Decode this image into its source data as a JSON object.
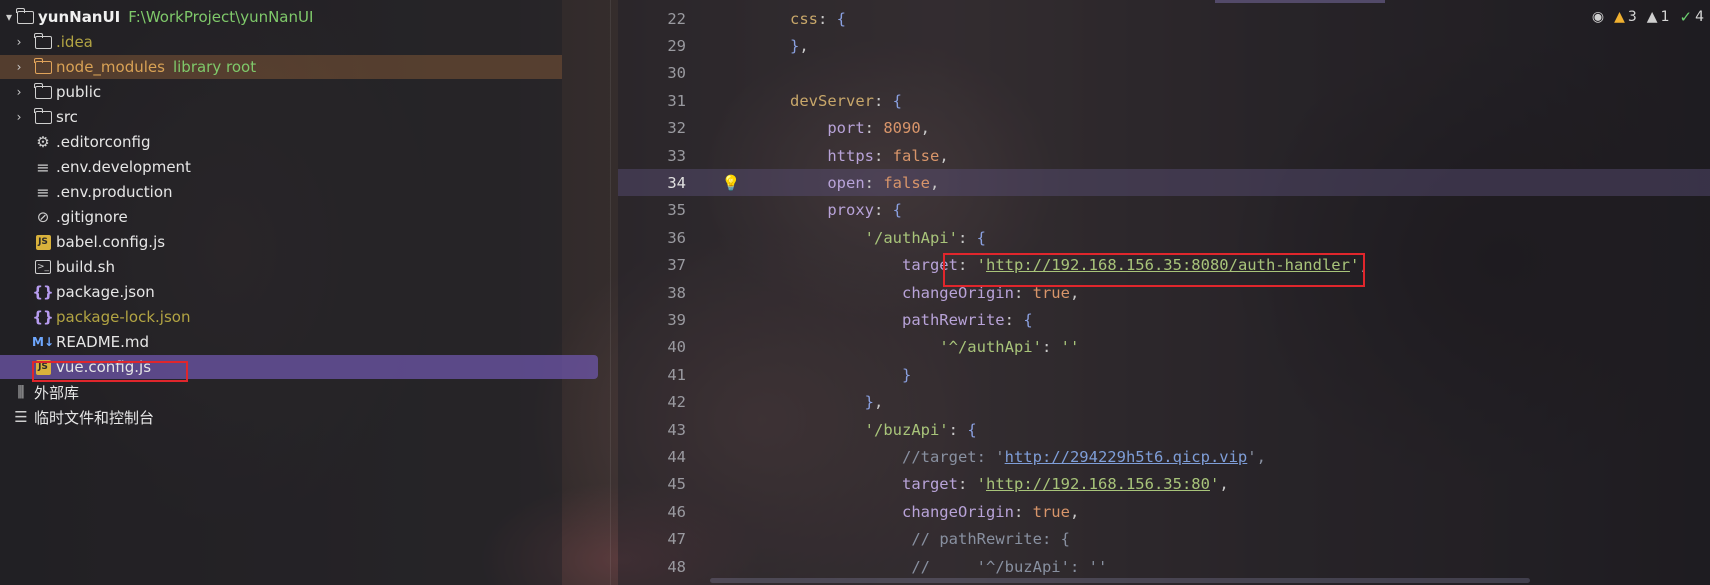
{
  "project": {
    "root": {
      "name": "yunNanUI",
      "path": "F:\\WorkProject\\yunNanUI"
    },
    "items": [
      {
        "label": ".idea",
        "type": "folder"
      },
      {
        "label": "node_modules",
        "type": "folder",
        "extra": "library root"
      },
      {
        "label": "public",
        "type": "folder"
      },
      {
        "label": "src",
        "type": "folder"
      },
      {
        "label": ".editorconfig",
        "type": "gear"
      },
      {
        "label": ".env.development",
        "type": "lines"
      },
      {
        "label": ".env.production",
        "type": "lines"
      },
      {
        "label": ".gitignore",
        "type": "ignore"
      },
      {
        "label": "babel.config.js",
        "type": "js"
      },
      {
        "label": "build.sh",
        "type": "terminal"
      },
      {
        "label": "package.json",
        "type": "json"
      },
      {
        "label": "package-lock.json",
        "type": "json"
      },
      {
        "label": "README.md",
        "type": "md"
      },
      {
        "label": "vue.config.js",
        "type": "js"
      }
    ],
    "external_libraries": "外部库",
    "scratches": "临时文件和控制台"
  },
  "editor": {
    "current_line": "34",
    "inspections": {
      "warnings": "3",
      "weak_warnings": "1",
      "ok": "4"
    },
    "lines": [
      {
        "num": "22",
        "t": [
          [
            "kw",
            "css"
          ],
          [
            "pun",
            ": "
          ],
          [
            "brace",
            "{"
          ]
        ]
      },
      {
        "num": "29",
        "t": [
          [
            "brace",
            "}"
          ],
          [
            "pun",
            ","
          ]
        ]
      },
      {
        "num": "30",
        "t": []
      },
      {
        "num": "31",
        "t": [
          [
            "kw",
            "devServer"
          ],
          [
            "pun",
            ": "
          ],
          [
            "brace",
            "{"
          ]
        ]
      },
      {
        "num": "32",
        "t": [
          [
            "plain",
            "    "
          ],
          [
            "prop",
            "port"
          ],
          [
            "pun",
            ": "
          ],
          [
            "num",
            "8090"
          ],
          [
            "pun",
            ","
          ]
        ]
      },
      {
        "num": "33",
        "t": [
          [
            "plain",
            "    "
          ],
          [
            "prop",
            "https"
          ],
          [
            "pun",
            ": "
          ],
          [
            "bool",
            "false"
          ],
          [
            "pun",
            ","
          ]
        ]
      },
      {
        "num": "34",
        "t": [
          [
            "plain",
            "    "
          ],
          [
            "prop",
            "open"
          ],
          [
            "pun",
            ": "
          ],
          [
            "bool",
            "false"
          ],
          [
            "pun",
            ","
          ]
        ]
      },
      {
        "num": "35",
        "t": [
          [
            "plain",
            "    "
          ],
          [
            "prop",
            "proxy"
          ],
          [
            "pun",
            ": "
          ],
          [
            "brace",
            "{"
          ]
        ]
      },
      {
        "num": "36",
        "t": [
          [
            "plain",
            "        "
          ],
          [
            "str",
            "'/authApi'"
          ],
          [
            "pun",
            ": "
          ],
          [
            "brace",
            "{"
          ]
        ]
      },
      {
        "num": "37",
        "t": [
          [
            "plain",
            "            "
          ],
          [
            "prop",
            "target"
          ],
          [
            "pun",
            ": "
          ],
          [
            "str",
            "'"
          ],
          [
            "url",
            "http://192.168.156.35:8080/auth-handler"
          ],
          [
            "str",
            "'"
          ],
          [
            "pun",
            ","
          ]
        ]
      },
      {
        "num": "38",
        "t": [
          [
            "plain",
            "            "
          ],
          [
            "prop",
            "changeOrigin"
          ],
          [
            "pun",
            ": "
          ],
          [
            "bool",
            "true"
          ],
          [
            "pun",
            ","
          ]
        ]
      },
      {
        "num": "39",
        "t": [
          [
            "plain",
            "            "
          ],
          [
            "prop",
            "pathRewrite"
          ],
          [
            "pun",
            ": "
          ],
          [
            "brace",
            "{"
          ]
        ]
      },
      {
        "num": "40",
        "t": [
          [
            "plain",
            "                "
          ],
          [
            "str",
            "'^/authApi'"
          ],
          [
            "pun",
            ": "
          ],
          [
            "str",
            "''"
          ]
        ]
      },
      {
        "num": "41",
        "t": [
          [
            "plain",
            "            "
          ],
          [
            "brace",
            "}"
          ]
        ]
      },
      {
        "num": "42",
        "t": [
          [
            "plain",
            "        "
          ],
          [
            "brace",
            "}"
          ],
          [
            "pun",
            ","
          ]
        ]
      },
      {
        "num": "43",
        "t": [
          [
            "plain",
            "        "
          ],
          [
            "str",
            "'/buzApi'"
          ],
          [
            "pun",
            ": "
          ],
          [
            "brace",
            "{"
          ]
        ]
      },
      {
        "num": "44",
        "t": [
          [
            "plain",
            "            "
          ],
          [
            "comment",
            "//target: '"
          ],
          [
            "curl",
            "http://294229h5t6.qicp.vip"
          ],
          [
            "comment",
            "',"
          ]
        ]
      },
      {
        "num": "45",
        "t": [
          [
            "plain",
            "            "
          ],
          [
            "prop",
            "target"
          ],
          [
            "pun",
            ": "
          ],
          [
            "str",
            "'"
          ],
          [
            "url",
            "http://192.168.156.35:80"
          ],
          [
            "str",
            "'"
          ],
          [
            "pun",
            ","
          ]
        ]
      },
      {
        "num": "46",
        "t": [
          [
            "plain",
            "            "
          ],
          [
            "prop",
            "changeOrigin"
          ],
          [
            "pun",
            ": "
          ],
          [
            "bool",
            "true"
          ],
          [
            "pun",
            ","
          ]
        ]
      },
      {
        "num": "47",
        "t": [
          [
            "plain",
            "             "
          ],
          [
            "comment",
            "// pathRewrite: {"
          ]
        ]
      },
      {
        "num": "48",
        "t": [
          [
            "plain",
            "             "
          ],
          [
            "comment",
            "//     '^/buzApi': ''"
          ]
        ]
      }
    ]
  },
  "colors": {
    "highlight_box": "#e0262c",
    "selection": "#6e55aa",
    "accent_green": "#7fc96a"
  }
}
